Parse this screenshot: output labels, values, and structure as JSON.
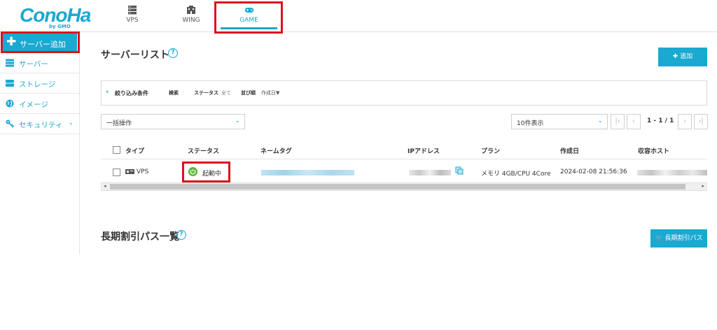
{
  "brand": {
    "logo_text": "ConoHa",
    "logo_sub": "by GMO"
  },
  "top_nav": {
    "tabs": [
      {
        "label": "VPS",
        "icon": "server-icon"
      },
      {
        "label": "WING",
        "icon": "building-icon"
      },
      {
        "label": "GAME",
        "icon": "gamepad-icon",
        "active": true
      }
    ]
  },
  "sidebar": {
    "add_button": "サーバー追加",
    "items": [
      {
        "label": "サーバー",
        "icon": "server-icon"
      },
      {
        "label": "ストレージ",
        "icon": "storage-icon"
      },
      {
        "label": "イメージ",
        "icon": "globe-icon"
      },
      {
        "label": "セキュリティ",
        "icon": "key-icon",
        "has_chevron": true
      }
    ]
  },
  "server_list": {
    "title": "サーバーリスト",
    "add_button": "追加",
    "filter": {
      "toggle_label": "絞り込み条件",
      "search_label": "検索",
      "search_value": "-",
      "status_label": "ステータス",
      "status_value": "全て",
      "sort_label": "並び順",
      "sort_value": "作成日▼"
    },
    "bulk_action": "一括操作",
    "page_size": "10件表示",
    "page_info": "1 - 1 / 1",
    "columns": [
      "タイプ",
      "ステータス",
      "ネームタグ",
      "IPアドレス",
      "プラン",
      "作成日",
      "収容ホスト"
    ],
    "rows": [
      {
        "type": "VPS",
        "status": "起動中",
        "plan": "メモリ 4GB/CPU 4Core",
        "created": "2024-02-08 21:56:36"
      }
    ]
  },
  "long_term_pass": {
    "title": "長期割引パス一覧",
    "button": "長期割引パス"
  },
  "colors": {
    "accent": "#19a9d1",
    "highlight": "#d9141e",
    "status_green": "#5bb434"
  }
}
